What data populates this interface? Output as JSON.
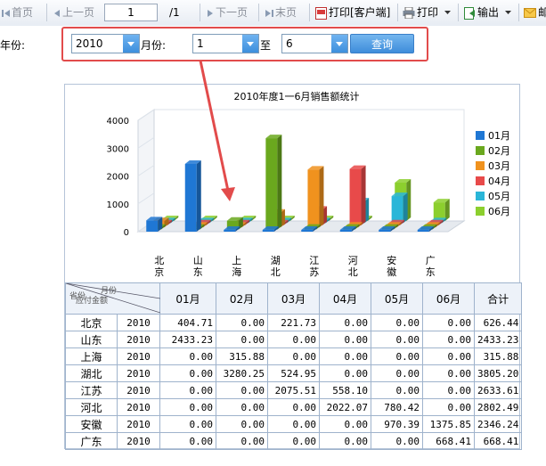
{
  "toolbar": {
    "first": "首页",
    "prev": "上一页",
    "page_value": "1",
    "page_total": "/1",
    "next": "下一页",
    "last": "末页",
    "print_client": "打印[客户端]",
    "print": "打印",
    "export": "输出",
    "mail": "邮"
  },
  "filter": {
    "year_label": "年份:",
    "year_value": "2010",
    "month_label": "月份:",
    "month_from": "1",
    "to_label": "至",
    "month_to": "6",
    "query_label": "查询"
  },
  "chart_data": {
    "type": "bar",
    "title": "2010年度1一6月销售额统计",
    "categories": [
      "北京",
      "山东",
      "上海",
      "湖北",
      "江苏",
      "河北",
      "安徽",
      "广东"
    ],
    "yticks": [
      0,
      1000,
      2000,
      3000,
      4000
    ],
    "ylim": [
      0,
      4000
    ],
    "legend_position": "right",
    "series": [
      {
        "name": "01月",
        "color": "#1f77d4",
        "values": [
          404.71,
          2433.23,
          0,
          0,
          0,
          0,
          0,
          0
        ]
      },
      {
        "name": "02月",
        "color": "#6aa81e",
        "values": [
          0,
          0,
          315.88,
          3280.25,
          0,
          0,
          0,
          0
        ]
      },
      {
        "name": "03月",
        "color": "#f0921e",
        "values": [
          221.73,
          0,
          0,
          524.95,
          2075.51,
          0,
          0,
          0
        ]
      },
      {
        "name": "04月",
        "color": "#e84a4a",
        "values": [
          0,
          0,
          0,
          0,
          558.1,
          2022.07,
          0,
          0
        ]
      },
      {
        "name": "05月",
        "color": "#2ab6d8",
        "values": [
          0,
          0,
          0,
          0,
          0,
          780.42,
          970.39,
          0
        ]
      },
      {
        "name": "06月",
        "color": "#8ccf2e",
        "values": [
          0,
          0,
          0,
          0,
          0,
          0,
          1375.85,
          668.41
        ]
      }
    ]
  },
  "table": {
    "header_month": "月份",
    "header_amount": "应付金额",
    "header_province": "省份",
    "columns": [
      "01月",
      "02月",
      "03月",
      "04月",
      "05月",
      "06月",
      "合计"
    ],
    "rows": [
      {
        "province": "北京",
        "year": "2010",
        "values": [
          "404.71",
          "0.00",
          "221.73",
          "0.00",
          "0.00",
          "0.00",
          "626.44"
        ]
      },
      {
        "province": "山东",
        "year": "2010",
        "values": [
          "2433.23",
          "0.00",
          "0.00",
          "0.00",
          "0.00",
          "0.00",
          "2433.23"
        ]
      },
      {
        "province": "上海",
        "year": "2010",
        "values": [
          "0.00",
          "315.88",
          "0.00",
          "0.00",
          "0.00",
          "0.00",
          "315.88"
        ]
      },
      {
        "province": "湖北",
        "year": "2010",
        "values": [
          "0.00",
          "3280.25",
          "524.95",
          "0.00",
          "0.00",
          "0.00",
          "3805.20"
        ]
      },
      {
        "province": "江苏",
        "year": "2010",
        "values": [
          "0.00",
          "0.00",
          "2075.51",
          "558.10",
          "0.00",
          "0.00",
          "2633.61"
        ]
      },
      {
        "province": "河北",
        "year": "2010",
        "values": [
          "0.00",
          "0.00",
          "0.00",
          "2022.07",
          "780.42",
          "0.00",
          "2802.49"
        ]
      },
      {
        "province": "安徽",
        "year": "2010",
        "values": [
          "0.00",
          "0.00",
          "0.00",
          "0.00",
          "970.39",
          "1375.85",
          "2346.24"
        ]
      },
      {
        "province": "广东",
        "year": "2010",
        "values": [
          "0.00",
          "0.00",
          "0.00",
          "0.00",
          "0.00",
          "668.41",
          "668.41"
        ]
      }
    ]
  }
}
